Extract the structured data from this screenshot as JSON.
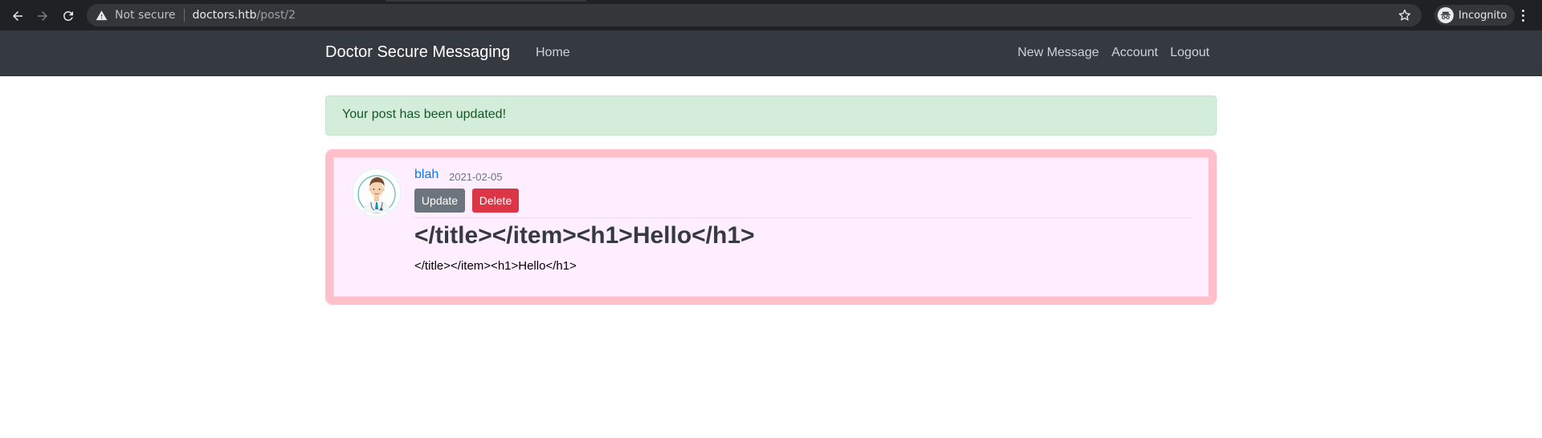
{
  "browser": {
    "security_label": "Not secure",
    "url_host": "doctors.htb",
    "url_path": "/post/2",
    "profile_label": "Incognito"
  },
  "site": {
    "brand": "Doctor Secure Messaging",
    "nav_left": [
      "Home"
    ],
    "nav_right": [
      "New Message",
      "Account",
      "Logout"
    ]
  },
  "alert": {
    "message": "Your post has been updated!"
  },
  "post": {
    "author": "blah",
    "date": "2021-02-05",
    "update_label": "Update",
    "delete_label": "Delete",
    "title": "</title></item><h1>Hello</h1>",
    "content": "</title></item><h1>Hello</h1>"
  },
  "icons": {
    "back": "arrow-left-icon",
    "forward": "arrow-right-icon",
    "reload": "reload-icon",
    "warning": "warning-triangle-icon",
    "bookmark": "star-icon",
    "incognito": "incognito-icon",
    "menu": "kebab-menu-icon",
    "avatar": "doctor-avatar"
  },
  "colors": {
    "navbar": "#343a40",
    "alert_bg": "#d4edda",
    "alert_text": "#155724",
    "card_border": "#ffc0cb",
    "card_bg": "#ffeeff",
    "link": "#007bff",
    "update_btn": "#6c757d",
    "delete_btn": "#dc3545"
  }
}
